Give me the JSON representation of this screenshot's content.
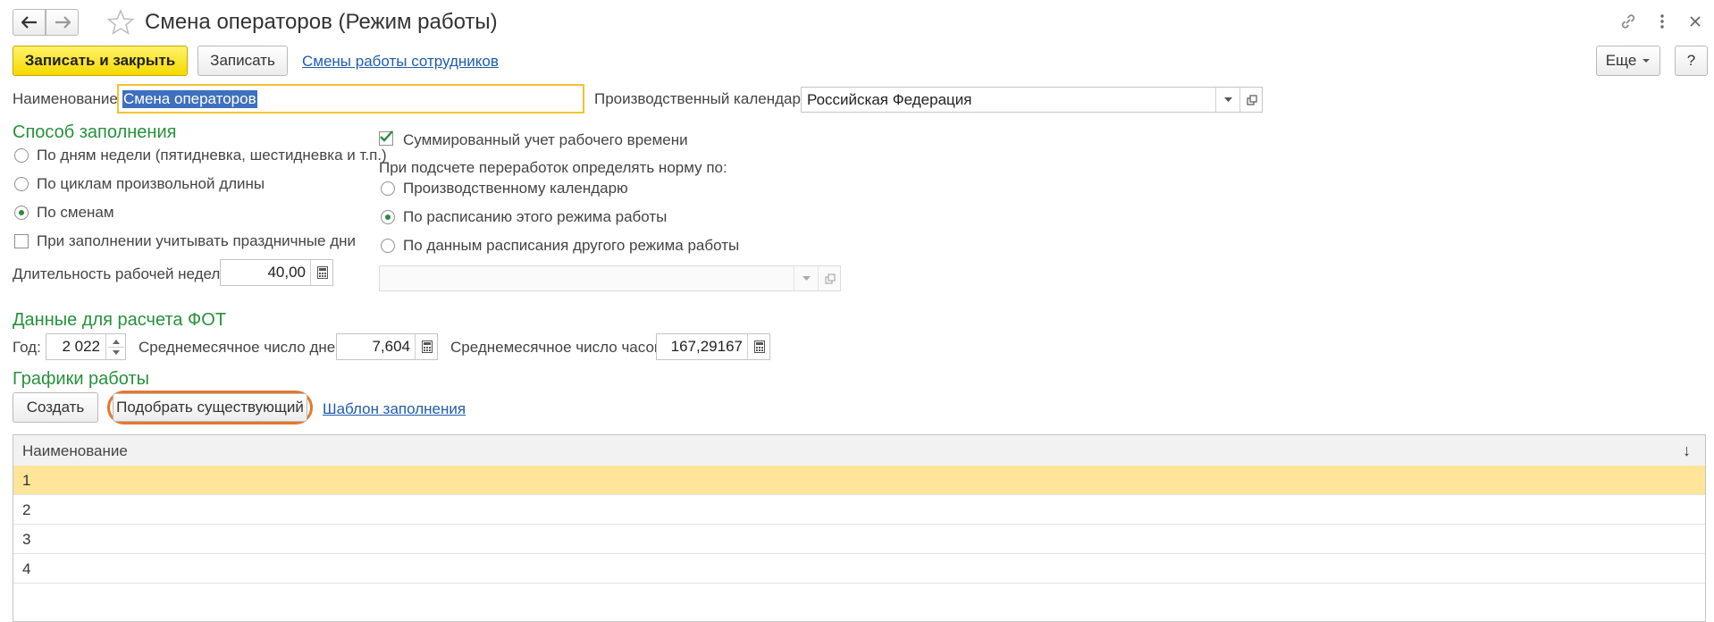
{
  "window": {
    "title": "Смена операторов (Режим работы)",
    "nav_back_icon": "arrow-left-icon",
    "nav_forward_icon": "arrow-right-icon",
    "favorite_icon": "star-icon",
    "link_icon": "link-icon",
    "more_icon": "vertical-dots-icon",
    "close_icon": "close-icon"
  },
  "toolbar": {
    "save_close_label": "Записать и закрыть",
    "save_label": "Записать",
    "link_label": "Смены работы сотрудников",
    "more_label": "Еще",
    "help_label": "?"
  },
  "form": {
    "name_label": "Наименование:",
    "name_value": "Смена операторов",
    "calendar_label": "Производственный календарь:",
    "calendar_value": "Российская Федерация"
  },
  "fill_method": {
    "title": "Способ заполнения",
    "options": [
      {
        "label": "По дням недели (пятидневка, шестидневка и т.п.)",
        "selected": false
      },
      {
        "label": "По циклам произвольной длины",
        "selected": false
      },
      {
        "label": "По сменам",
        "selected": true
      }
    ],
    "holidays_label": "При заполнении учитывать праздничные дни",
    "holidays_checked": false,
    "week_duration_label": "Длительность рабочей недели:",
    "week_duration_value": "40,00"
  },
  "summary": {
    "summarized_label": "Суммированный учет рабочего времени",
    "summarized_checked": true,
    "norm_label": "При подсчете переработок определять норму по:",
    "norm_options": [
      {
        "label": "Производственному календарю",
        "selected": false
      },
      {
        "label": "По расписанию этого режима работы",
        "selected": true
      },
      {
        "label": "По данным расписания другого режима работы",
        "selected": false
      }
    ],
    "other_schedule_value": ""
  },
  "payroll": {
    "title": "Данные для расчета ФОТ",
    "year_label": "Год:",
    "year_value": "2 022",
    "avg_days_label": "Среднемесячное число дней:",
    "avg_days_value": "7,604",
    "avg_hours_label": "Среднемесячное число часов:",
    "avg_hours_value": "167,29167"
  },
  "schedules": {
    "title": "Графики работы",
    "create_label": "Создать",
    "pick_existing_label": "Подобрать существующий",
    "template_link_label": "Шаблон заполнения",
    "column_header": "Наименование",
    "sort_glyph": "↓",
    "rows": [
      "1",
      "2",
      "3",
      "4"
    ],
    "highlight_color": "#ffe49a",
    "callout_color": "#e8762c"
  }
}
